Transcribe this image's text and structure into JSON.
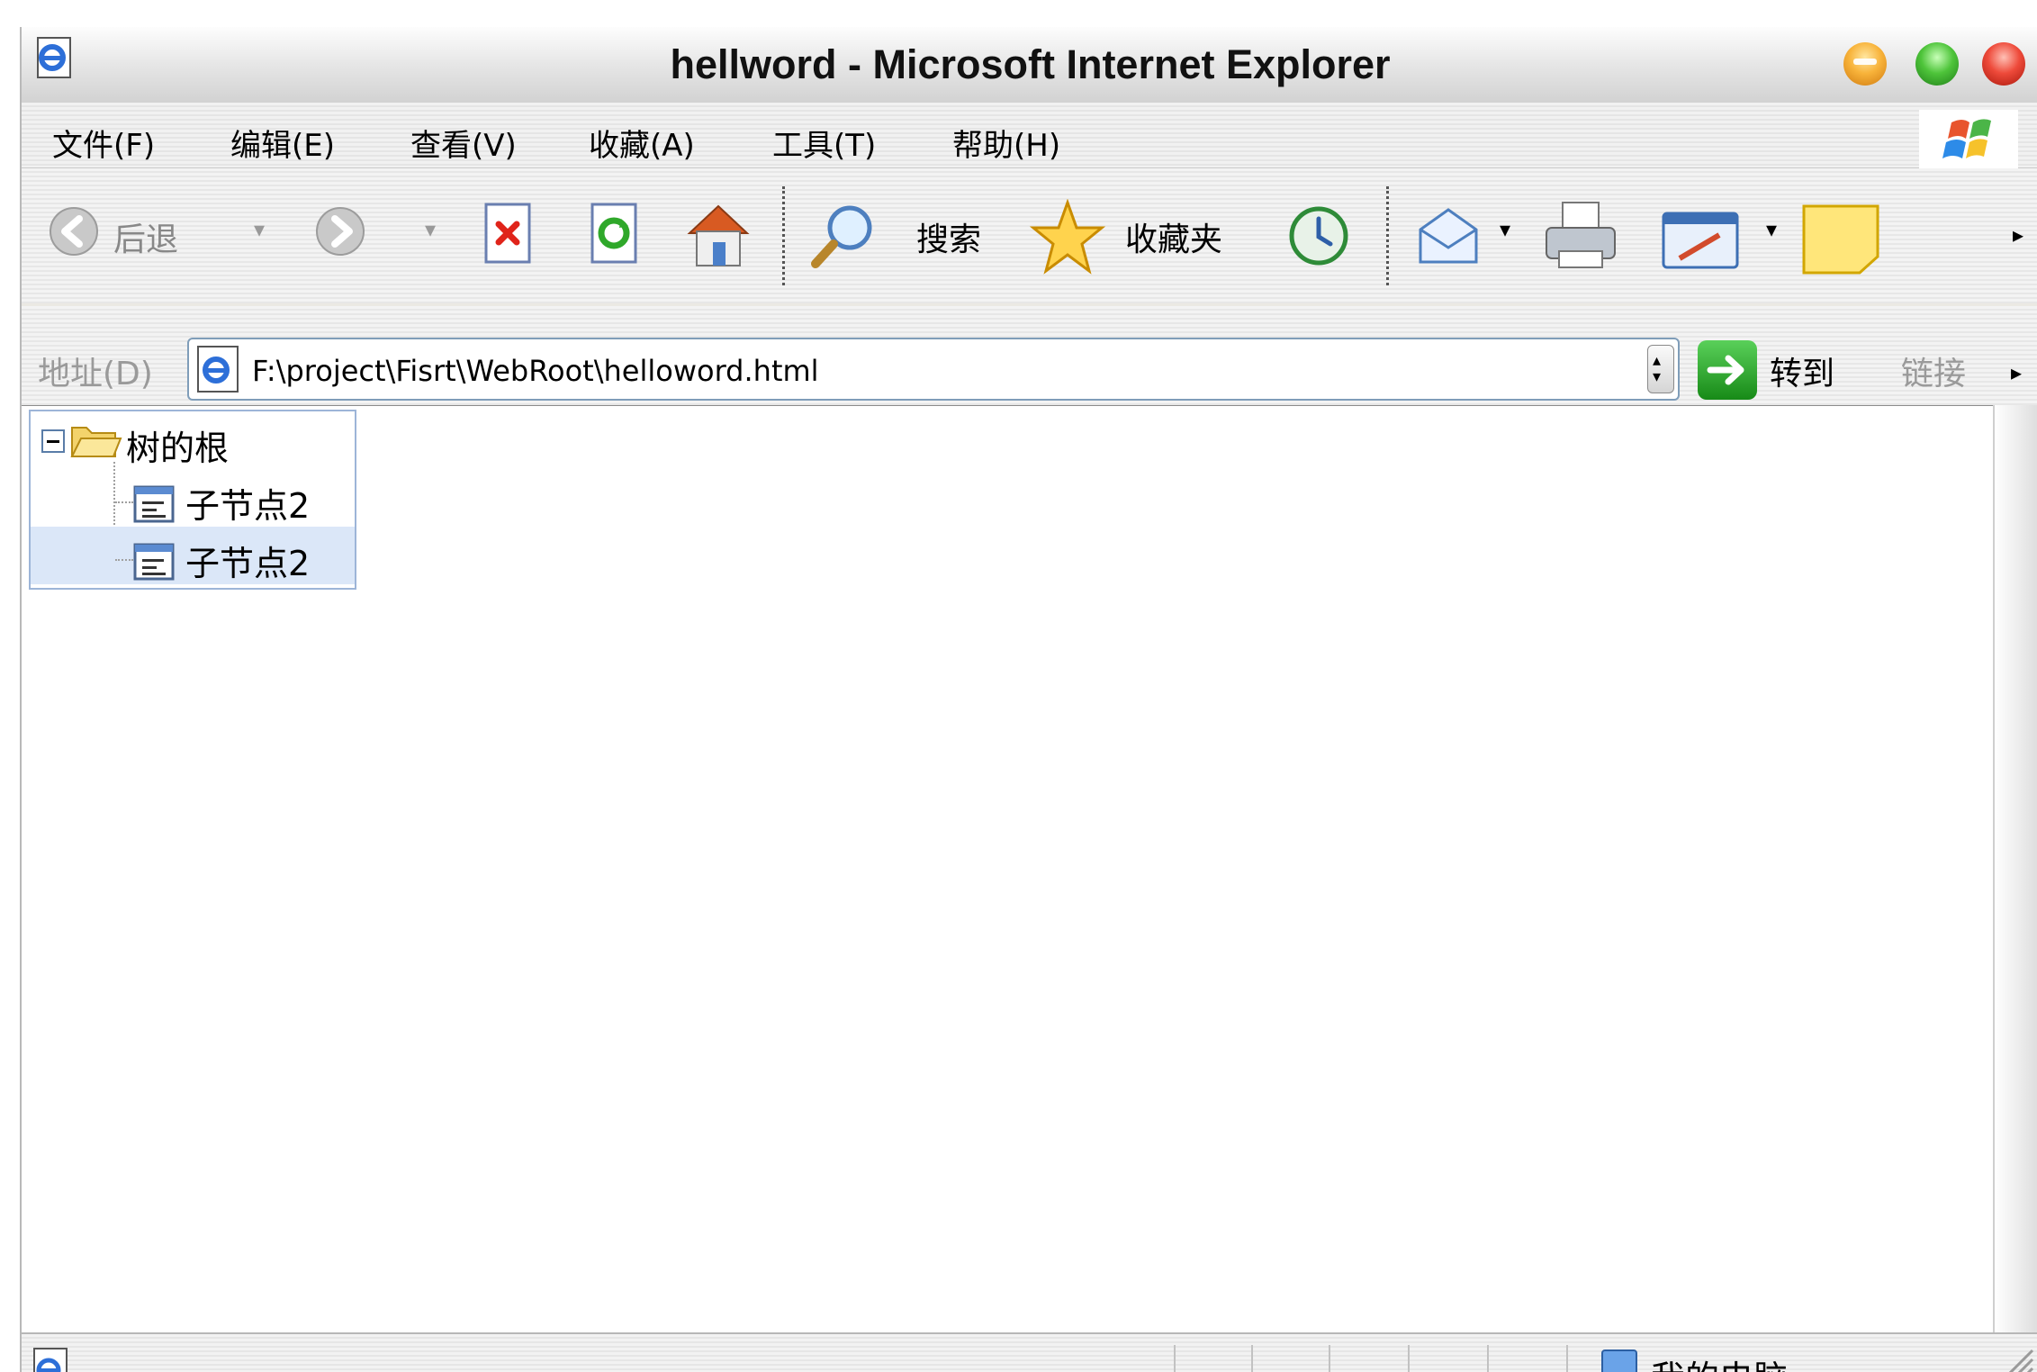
{
  "window": {
    "title": "hellword - Microsoft Internet Explorer"
  },
  "menubar": {
    "items": [
      {
        "label": "文件(F)"
      },
      {
        "label": "编辑(E)"
      },
      {
        "label": "查看(V)"
      },
      {
        "label": "收藏(A)"
      },
      {
        "label": "工具(T)"
      },
      {
        "label": "帮助(H)"
      }
    ]
  },
  "toolbar": {
    "back_label": "后退",
    "search_label": "搜索",
    "favorites_label": "收藏夹"
  },
  "addressbar": {
    "label": "地址(D)",
    "url": "F:\\project\\Fisrt\\WebRoot\\helloword.html",
    "go_label": "转到",
    "links_label": "链接"
  },
  "tree": {
    "root_label": "树的根",
    "children": [
      {
        "label": "子节点2",
        "selected": false
      },
      {
        "label": "子节点2",
        "selected": true
      }
    ]
  },
  "statusbar": {
    "zone_label": "我的电脑"
  },
  "colors": {
    "selected_row": "#dbe7f8",
    "tree_border": "#9db5d8",
    "address_border": "#7f9db9"
  }
}
